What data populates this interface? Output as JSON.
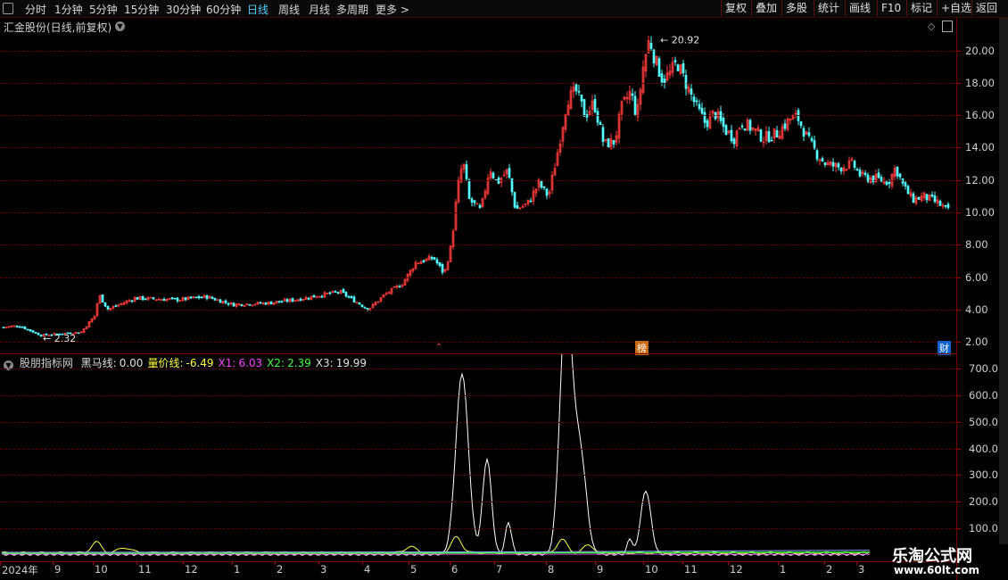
{
  "toolbar": {
    "timeframes": [
      "分时",
      "1分钟",
      "5分钟",
      "15分钟",
      "30分钟",
      "60分钟",
      "日线",
      "周线",
      "月线",
      "多周期",
      "更多 >"
    ],
    "active_timeframe": "日线",
    "buttons": [
      "复权",
      "叠加",
      "多股",
      "统计",
      "画线",
      "F10",
      "标记",
      "+自选",
      "返回"
    ]
  },
  "kline": {
    "title": "汇金股份(日线,前复权)",
    "y_ticks": [
      "20.00",
      "18.00",
      "16.00",
      "14.00",
      "12.00",
      "10.00",
      "8.00",
      "6.00",
      "4.00",
      "2.00"
    ],
    "max_label": "20.92",
    "min_label": "2.32",
    "badge_bang": "榜",
    "badge_cai": "财"
  },
  "indicator": {
    "name": "股朋指标网",
    "values": [
      {
        "label": "黑马线:",
        "value": "0.00",
        "color": "#e0e0e0"
      },
      {
        "label": "量价线:",
        "value": "-6.49",
        "color": "#ffff40"
      },
      {
        "label": "X1:",
        "value": "6.03",
        "color": "#ff40ff"
      },
      {
        "label": "X2:",
        "value": "2.39",
        "color": "#40ff40"
      },
      {
        "label": "X3:",
        "value": "19.99",
        "color": "#e0e0e0"
      }
    ],
    "y_ticks": [
      "700.0",
      "600.0",
      "500.0",
      "400.0",
      "300.0",
      "200.0",
      "100.0"
    ]
  },
  "x_axis": {
    "labels": [
      "2024年",
      "9",
      "10",
      "11",
      "12",
      "1",
      "2",
      "3",
      "4",
      "5",
      "6",
      "7",
      "8",
      "9",
      "10",
      "11",
      "12",
      "1",
      "2",
      "3"
    ]
  },
  "watermark": {
    "main": "乐淘公式网",
    "url": "www.60lt.com"
  },
  "colors": {
    "up": "#ff3c3c",
    "down": "#54ffff",
    "grid": "#5a0000",
    "active": "#4fd0ff"
  }
}
